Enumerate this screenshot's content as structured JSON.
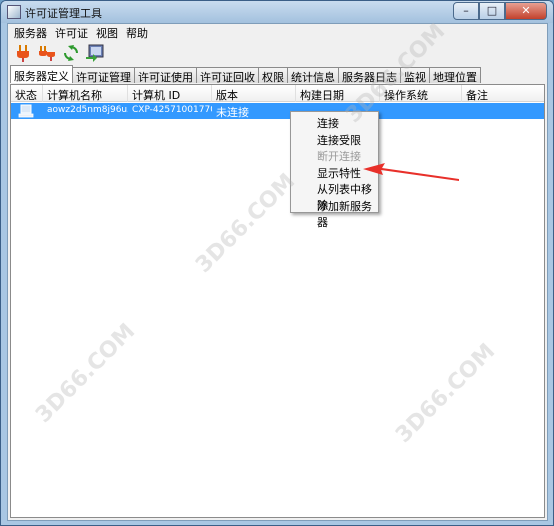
{
  "window": {
    "title": "许可证管理工具",
    "minimize_label": "–",
    "maximize_label": "□",
    "close_label": "✕"
  },
  "menu": [
    "服务器",
    "许可证",
    "视图",
    "帮助"
  ],
  "toolbar": {
    "icons": [
      "plug-connect-icon",
      "plug-disconnect-icon",
      "refresh-icon",
      "add-server-icon"
    ]
  },
  "tabs": [
    {
      "label": "服务器定义",
      "active": true
    },
    {
      "label": "许可证管理",
      "active": false
    },
    {
      "label": "许可证使用",
      "active": false
    },
    {
      "label": "许可证回收",
      "active": false
    },
    {
      "label": "权限",
      "active": false
    },
    {
      "label": "统计信息",
      "active": false
    },
    {
      "label": "服务器日志",
      "active": false
    },
    {
      "label": "监视",
      "active": false
    },
    {
      "label": "地理位置",
      "active": false
    }
  ],
  "table": {
    "columns": [
      "状态",
      "计算机名称",
      "计算机 ID",
      "版本",
      "构建日期",
      "操作系统",
      "备注"
    ],
    "rows": [
      {
        "status_icon": "computer-icon",
        "computer_name": "aowz2d5nm8j96u5",
        "computer_id": "CXP-42571001770076",
        "version": "未连接",
        "build_date": "",
        "os": "",
        "note": ""
      }
    ]
  },
  "context_menu": [
    {
      "label": "连接",
      "disabled": false
    },
    {
      "label": "连接受限",
      "disabled": false
    },
    {
      "label": "断开连接",
      "disabled": true
    },
    {
      "label": "显示特性",
      "disabled": false
    },
    {
      "label": "从列表中移除",
      "disabled": false
    },
    {
      "label": "添加新服务器",
      "disabled": false
    }
  ],
  "watermarks": [
    "3D66.COM",
    "3D66.COM",
    "3D66.COM",
    "3D66.COM"
  ],
  "colors": {
    "selection": "#3399ff",
    "arrow": "#e8302a"
  }
}
